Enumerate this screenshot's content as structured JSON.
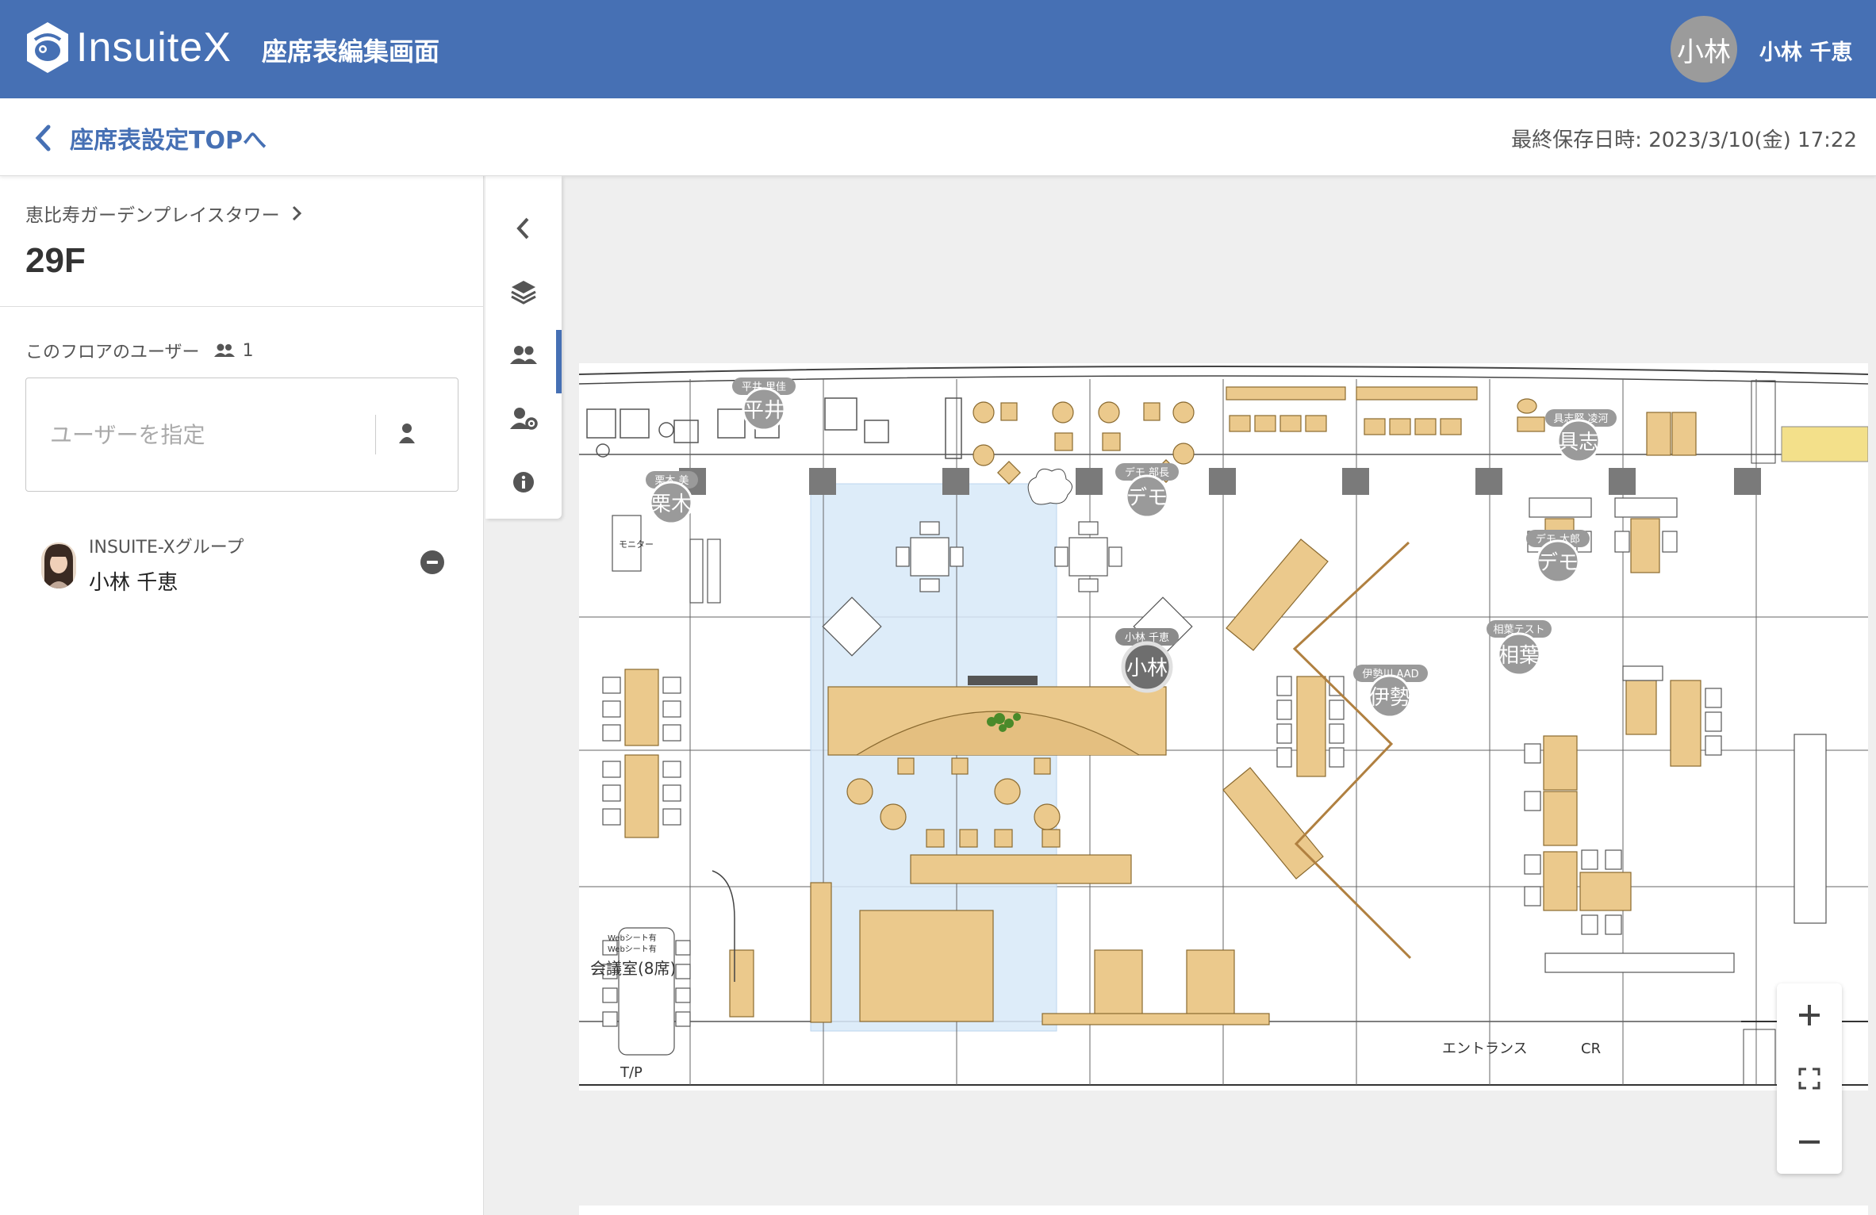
{
  "header": {
    "logo_text": "InsuiteX",
    "title": "座席表編集画面",
    "user_avatar_text": "小林",
    "user_name": "小林 千恵",
    "bg_color": "#4670b4"
  },
  "subbar": {
    "back_label": "座席表設定TOPへ",
    "last_saved": "最終保存日時: 2023/3/10(金) 17:22"
  },
  "left_panel": {
    "building": "恵比寿ガーデンプレイスタワー",
    "floor": "29F",
    "floor_users_label": "このフロアのユーザー",
    "floor_users_count": "1",
    "user_input_placeholder": "ユーザーを指定",
    "users": [
      {
        "group": "INSUITE-Xグループ",
        "name": "小林 千恵"
      }
    ]
  },
  "toolbar": {
    "items": [
      "collapse-icon",
      "layers-icon",
      "users-icon",
      "user-settings-icon",
      "info-icon"
    ],
    "active": "users-icon"
  },
  "map": {
    "labels": {
      "meeting_room": "会議室(8席)",
      "entrance": "エントランス",
      "tp": "T/P",
      "cr": "CR",
      "monitor": "モニター",
      "web_seat_1": "Webシート有",
      "web_seat_2": "Webシート有"
    },
    "pins": [
      {
        "label": "平井 里佳",
        "initial": "平井",
        "highlight": false
      },
      {
        "label": "具志堅 凌河",
        "initial": "具志",
        "highlight": false
      },
      {
        "label": "栗木 美",
        "initial": "栗木",
        "highlight": false
      },
      {
        "label": "デモ 部長",
        "initial": "デモ",
        "highlight": false
      },
      {
        "label": "デモ 太郎",
        "initial": "デモ",
        "highlight": false
      },
      {
        "label": "小林 千恵",
        "initial": "小林",
        "highlight": true
      },
      {
        "label": "相葉テスト",
        "initial": "相葉",
        "highlight": false
      },
      {
        "label": "伊勢川 AAD",
        "initial": "伊勢",
        "highlight": false
      }
    ]
  },
  "zoom": {
    "items": [
      "plus-icon",
      "fit-screen-icon",
      "minus-icon"
    ]
  }
}
